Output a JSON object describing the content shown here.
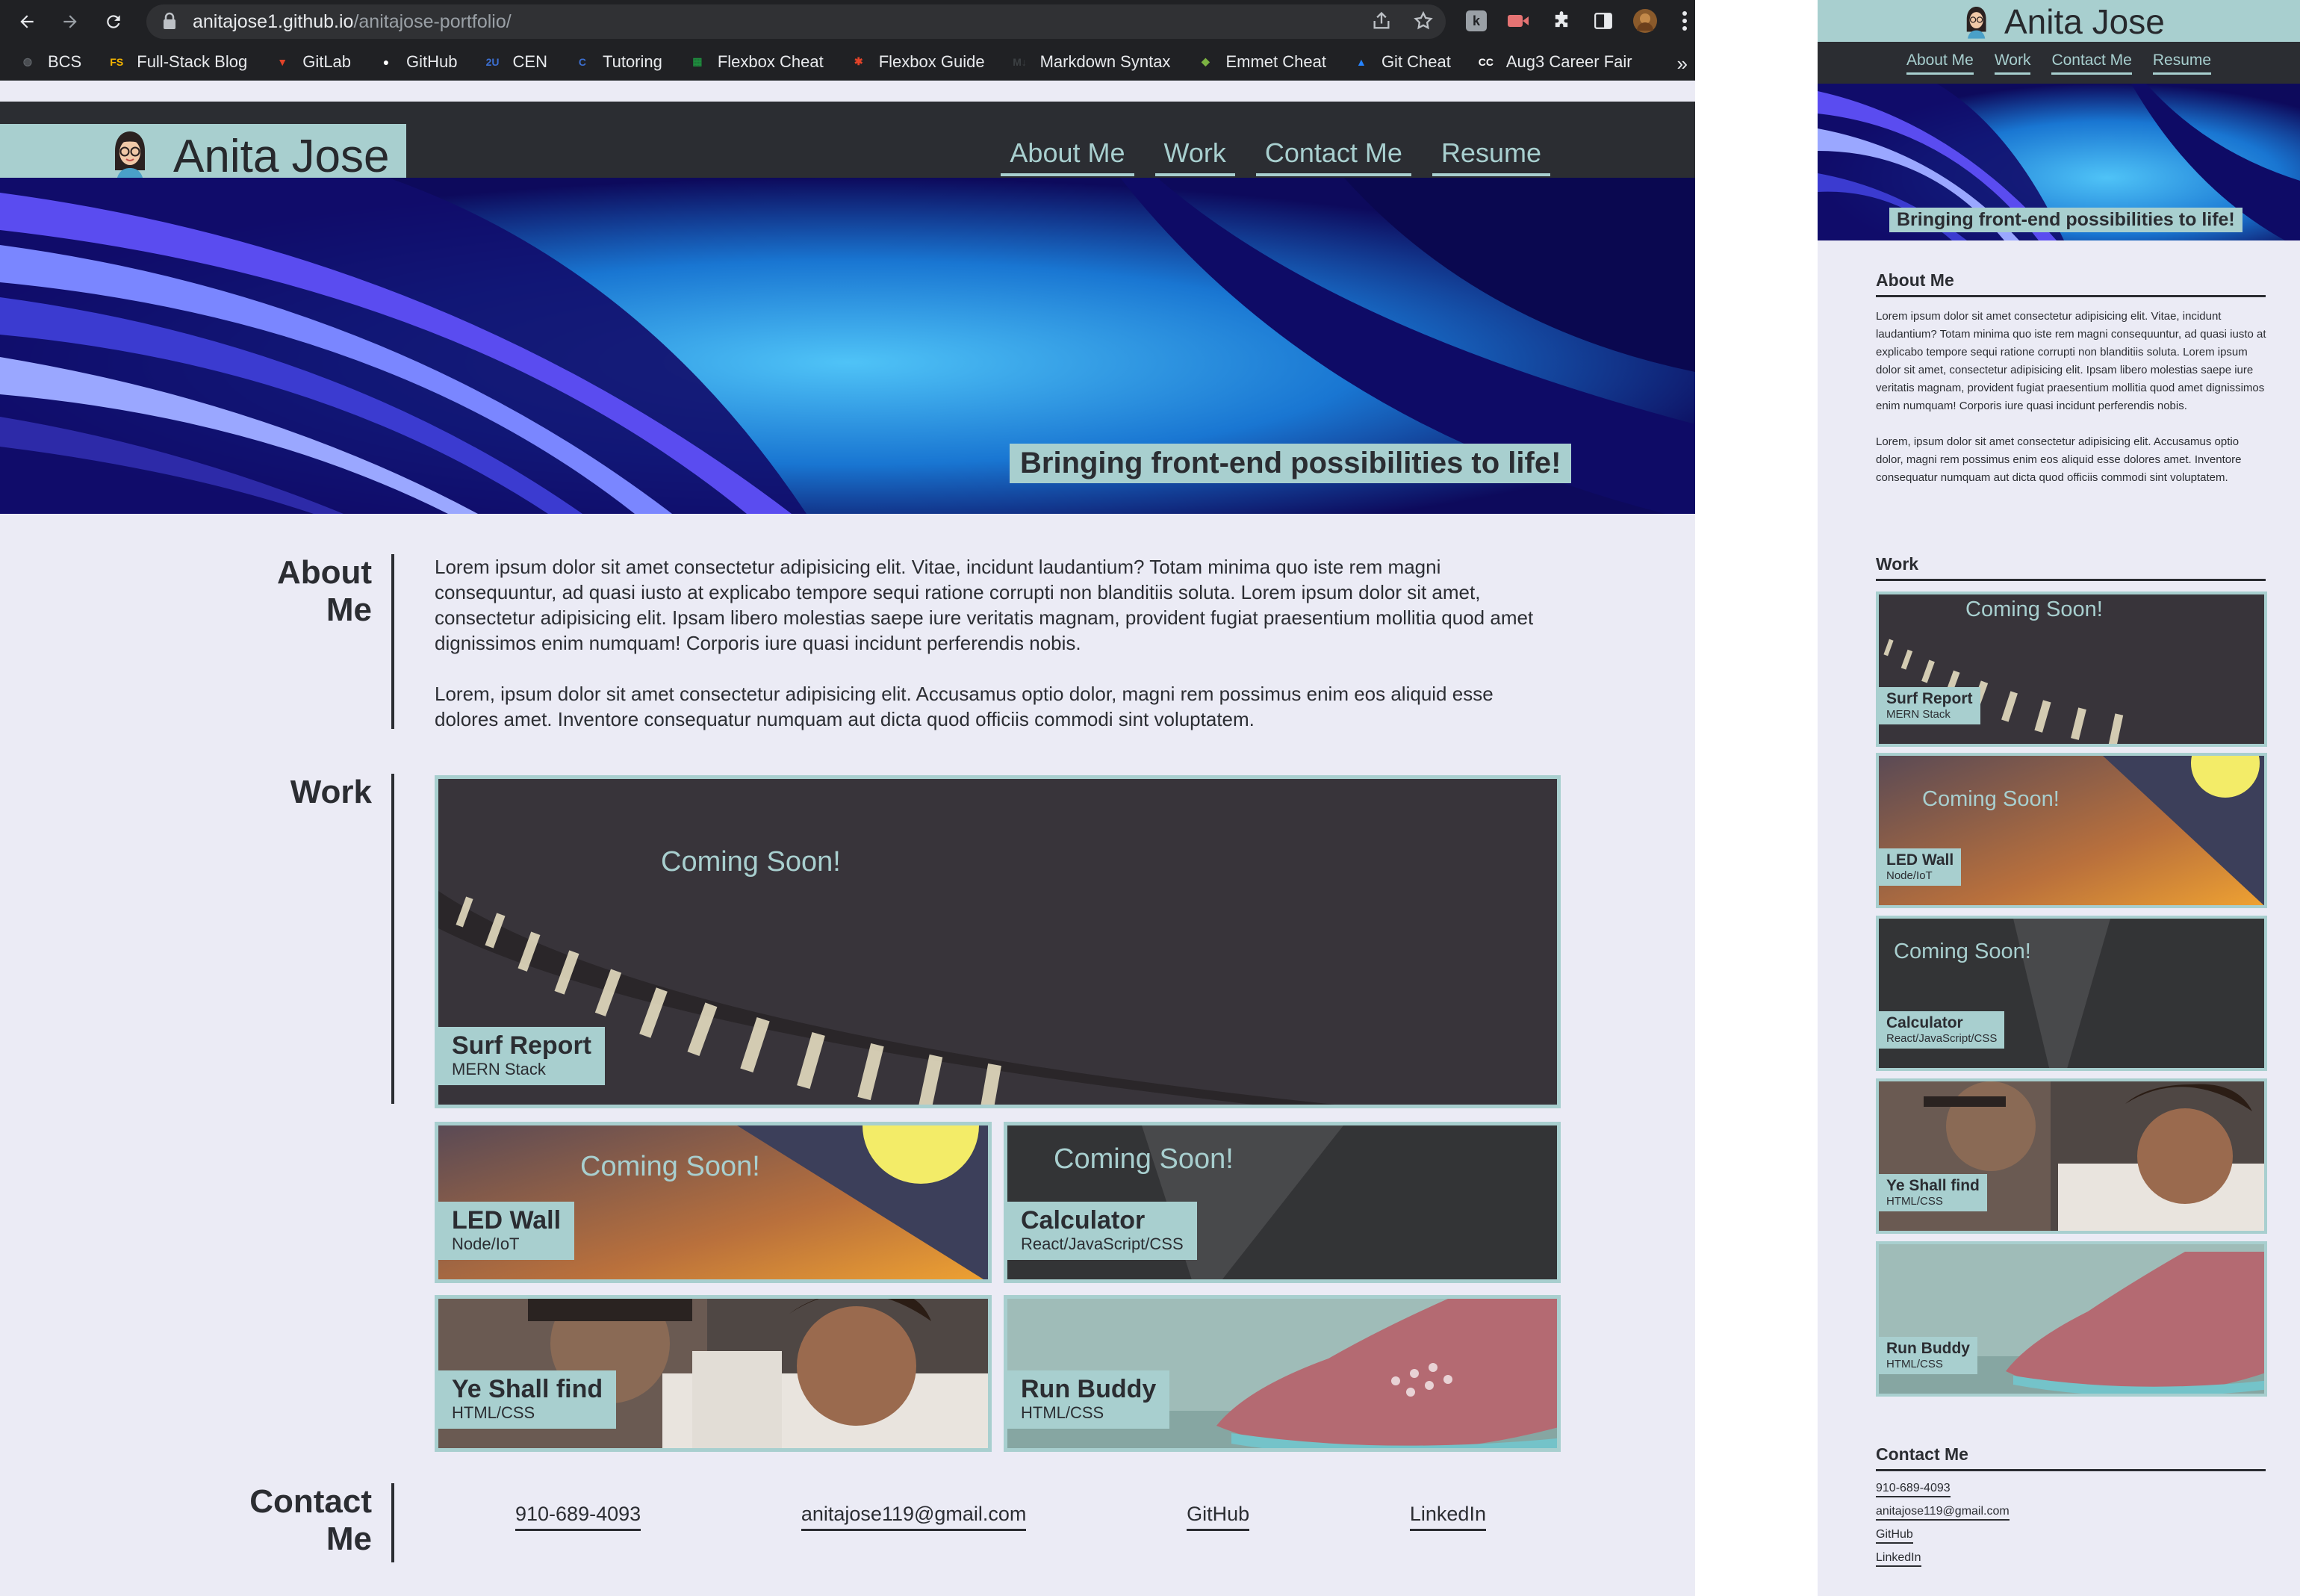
{
  "browser": {
    "url_host": "anitajose1.github.io",
    "url_path": "/anitajose-portfolio/",
    "nav": [
      "back-icon",
      "forward-icon",
      "reload-icon"
    ],
    "bookmarks": [
      {
        "label": "BCS",
        "icon": "globe-icon",
        "color": "#5f6368"
      },
      {
        "label": "Full-Stack Blog",
        "icon": "fs-icon",
        "color": "#f4b400"
      },
      {
        "label": "GitLab",
        "icon": "gitlab-icon",
        "color": "#e24329"
      },
      {
        "label": "GitHub",
        "icon": "github-icon",
        "color": "#ffffff"
      },
      {
        "label": "CEN",
        "icon": "2u-icon",
        "color": "#3c6fd1"
      },
      {
        "label": "Tutoring",
        "icon": "tutoring-icon",
        "color": "#3c6fd1"
      },
      {
        "label": "Flexbox Cheat",
        "icon": "flexbox-icon",
        "color": "#1e8e3e"
      },
      {
        "label": "Flexbox Guide",
        "icon": "asterisk-icon",
        "color": "#e24329"
      },
      {
        "label": "Markdown Syntax",
        "icon": "markdown-icon",
        "color": "#3c4043"
      },
      {
        "label": "Emmet Cheat",
        "icon": "emmet-icon",
        "color": "#7cb342"
      },
      {
        "label": "Git Cheat",
        "icon": "atlassian-icon",
        "color": "#2684ff"
      },
      {
        "label": "Aug3 Career Fair",
        "icon": "cc-icon",
        "color": "#ffffff"
      }
    ],
    "more": "»"
  },
  "site": {
    "title": "Anita Jose",
    "nav": [
      "About Me",
      "Work",
      "Contact Me",
      "Resume"
    ],
    "tagline": "Bringing front-end possibilities to life!",
    "about": {
      "heading_line1": "About",
      "heading_line2": "Me",
      "heading_mobile": "About Me",
      "p1": "Lorem ipsum dolor sit amet consectetur adipisicing elit. Vitae, incidunt laudantium? Totam minima quo iste rem magni consequuntur, ad quasi iusto at explicabo tempore sequi ratione corrupti non blanditiis soluta. Lorem ipsum dolor sit amet, consectetur adipisicing elit. Ipsam libero molestias saepe iure veritatis magnam, provident fugiat praesentium mollitia quod amet dignissimos enim numquam! Corporis iure quasi incidunt perferendis nobis.",
      "p2": "Lorem, ipsum dolor sit amet consectetur adipisicing elit. Accusamus optio dolor, magni rem possimus enim eos aliquid esse dolores amet. Inventore consequatur numquam aut dicta quod officiis commodi sint voluptatem."
    },
    "work": {
      "heading": "Work",
      "coming_soon": "Coming Soon!",
      "projects": [
        {
          "title": "Surf Report",
          "stack": "MERN Stack"
        },
        {
          "title": "LED Wall",
          "stack": "Node/IoT"
        },
        {
          "title": "Calculator",
          "stack": "React/JavaScript/CSS"
        },
        {
          "title": "Ye Shall find",
          "stack": "HTML/CSS"
        },
        {
          "title": "Run Buddy",
          "stack": "HTML/CSS"
        }
      ]
    },
    "contact": {
      "heading_line1": "Contact",
      "heading_line2": "Me",
      "heading_mobile": "Contact Me",
      "links": [
        "910-689-4093",
        "anitajose119@gmail.com",
        "GitHub",
        "LinkedIn"
      ]
    },
    "colors": {
      "accent": "#a8cfcf",
      "dark": "#2b2d32",
      "background": "#ebebf5"
    }
  }
}
